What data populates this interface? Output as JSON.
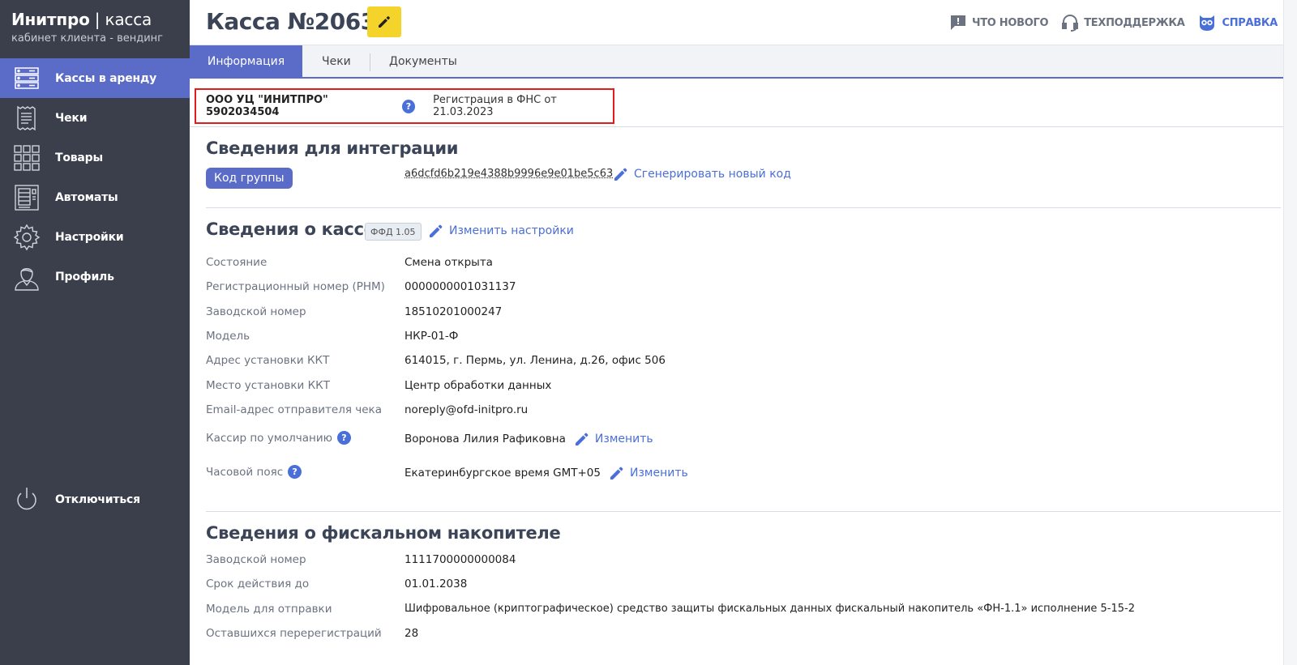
{
  "brand": {
    "title_bold": "Инитпро",
    "title_sep": " | ",
    "title_rest": "касса",
    "subtitle": "кабинет клиента - вендинг"
  },
  "sidebar": {
    "items": [
      {
        "label": "Кассы в аренду",
        "icon": "server-icon",
        "active": true
      },
      {
        "label": "Чеки",
        "icon": "receipt-icon"
      },
      {
        "label": "Товары",
        "icon": "grid-icon"
      },
      {
        "label": "Автоматы",
        "icon": "vending-machine-icon"
      },
      {
        "label": "Настройки",
        "icon": "gear-icon"
      },
      {
        "label": "Профиль",
        "icon": "user-icon"
      }
    ],
    "logout_label": "Отключиться"
  },
  "header": {
    "title": "Касса №2063",
    "links": {
      "whats_new": "ЧТО НОВОГО",
      "support": "ТЕХПОДДЕРЖКА",
      "help": "СПРАВКА"
    }
  },
  "tabs": [
    "Информация",
    "Чеки",
    "Документы"
  ],
  "org": {
    "name": "ООО УЦ \"ИНИТПРО\" 5902034504",
    "registration": "Регистрация в ФНС от 21.03.2023"
  },
  "integration": {
    "title": "Сведения для интеграции",
    "group_button": "Код группы",
    "group_code": "a6dcfd6b219e4388b9996e9e01be5c63",
    "generate_link": "Сгенерировать новый код"
  },
  "kassa": {
    "title": "Сведения о кассе",
    "ffd_badge": "ФФД 1.05",
    "change_settings": "Изменить настройки",
    "rows": [
      {
        "label": "Состояние",
        "value": "Смена открыта"
      },
      {
        "label": "Регистрационный номер (РНМ)",
        "value": "0000000001031137"
      },
      {
        "label": "Заводской номер",
        "value": "18510201000247"
      },
      {
        "label": "Модель",
        "value": "НКР-01-Ф"
      },
      {
        "label": "Адрес установки ККТ",
        "value": "614015, г. Пермь, ул. Ленина, д.26, офис 506"
      },
      {
        "label": "Место установки ККТ",
        "value": "Центр обработки данных"
      },
      {
        "label": "Email-адрес отправителя чека",
        "value": "noreply@ofd-initpro.ru"
      },
      {
        "label": "Кассир по умолчанию",
        "value": "Воронова Лилия Рафиковна",
        "action": "Изменить"
      },
      {
        "label": "Часовой пояс",
        "value": "Екатеринбургское время GMT+05",
        "action": "Изменить"
      }
    ]
  },
  "fn": {
    "title": "Сведения о фискальном накопителе",
    "rows": [
      {
        "label": "Заводской номер",
        "value": "1111700000000084"
      },
      {
        "label": "Срок действия до",
        "value": "01.01.2038"
      },
      {
        "label": "Модель для отправки",
        "value": "Шифровальное (криптографическое) средство защиты фискальных данных фискальный накопитель «ФН-1.1» исполнение 5-15-2"
      },
      {
        "label": "Оставшихся перерегистраций",
        "value": "28"
      }
    ]
  },
  "colors": {
    "sidebar": "#3a3f4b",
    "accent": "#5b6bc8",
    "link": "#4a6fd8",
    "highlight": "#e21c1c",
    "edit_button": "#f4d32a"
  }
}
